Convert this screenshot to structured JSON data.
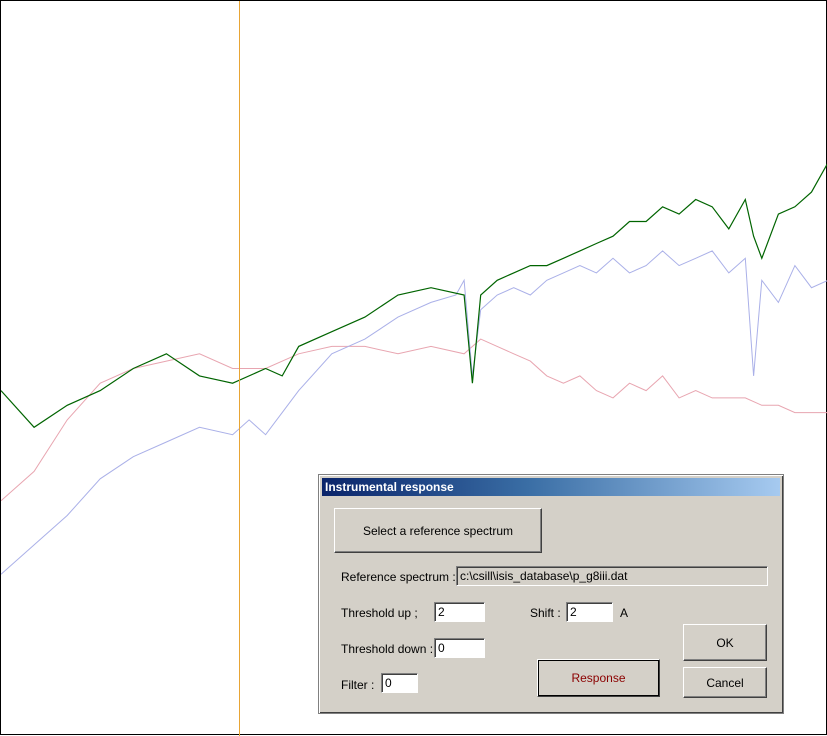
{
  "chart_data": {
    "type": "line",
    "x_range": [
      0,
      100
    ],
    "y_range": [
      0,
      1
    ],
    "grid": false,
    "legend": "none",
    "series": [
      {
        "color": "#006400",
        "x": [
          0,
          4,
          8,
          12,
          16,
          20,
          24,
          28,
          32,
          34,
          36,
          40,
          44,
          48,
          52,
          56,
          57,
          58,
          60,
          62,
          64,
          66,
          68,
          70,
          72,
          74,
          76,
          78,
          80,
          82,
          84,
          86,
          88,
          90,
          91,
          92,
          94,
          96,
          98,
          100
        ],
        "y": [
          0.47,
          0.42,
          0.45,
          0.47,
          0.5,
          0.52,
          0.49,
          0.48,
          0.5,
          0.49,
          0.53,
          0.55,
          0.57,
          0.6,
          0.61,
          0.6,
          0.48,
          0.6,
          0.62,
          0.63,
          0.64,
          0.64,
          0.65,
          0.66,
          0.67,
          0.68,
          0.7,
          0.7,
          0.72,
          0.71,
          0.73,
          0.72,
          0.69,
          0.73,
          0.68,
          0.65,
          0.71,
          0.72,
          0.74,
          0.78
        ]
      },
      {
        "color": "#aab0e8",
        "x": [
          0,
          4,
          8,
          12,
          16,
          20,
          24,
          28,
          30,
          32,
          34,
          36,
          40,
          44,
          48,
          52,
          55,
          56,
          57,
          58,
          60,
          62,
          64,
          66,
          68,
          70,
          72,
          74,
          76,
          78,
          80,
          82,
          84,
          86,
          88,
          90,
          91,
          92,
          94,
          96,
          98,
          100
        ],
        "y": [
          0.22,
          0.26,
          0.3,
          0.35,
          0.38,
          0.4,
          0.42,
          0.41,
          0.43,
          0.41,
          0.44,
          0.47,
          0.52,
          0.54,
          0.57,
          0.59,
          0.6,
          0.62,
          0.49,
          0.58,
          0.6,
          0.61,
          0.6,
          0.62,
          0.63,
          0.64,
          0.63,
          0.65,
          0.63,
          0.64,
          0.66,
          0.64,
          0.65,
          0.66,
          0.63,
          0.65,
          0.49,
          0.62,
          0.59,
          0.64,
          0.61,
          0.62
        ]
      },
      {
        "color": "#e8a5b0",
        "x": [
          0,
          4,
          8,
          12,
          16,
          20,
          24,
          28,
          32,
          36,
          40,
          44,
          48,
          52,
          56,
          58,
          60,
          62,
          64,
          66,
          68,
          70,
          72,
          74,
          76,
          78,
          80,
          82,
          84,
          86,
          88,
          90,
          92,
          94,
          96,
          98,
          100
        ],
        "y": [
          0.32,
          0.36,
          0.43,
          0.48,
          0.5,
          0.51,
          0.52,
          0.5,
          0.5,
          0.52,
          0.53,
          0.53,
          0.52,
          0.53,
          0.52,
          0.54,
          0.53,
          0.52,
          0.51,
          0.49,
          0.48,
          0.49,
          0.47,
          0.46,
          0.48,
          0.47,
          0.49,
          0.46,
          0.47,
          0.46,
          0.46,
          0.46,
          0.45,
          0.45,
          0.44,
          0.44,
          0.44
        ]
      }
    ]
  },
  "cursor": {
    "color": "#e8a535"
  },
  "dialog": {
    "title": "Instrumental response",
    "select_button": "Select a reference spectrum",
    "reference_label": "Reference spectrum :",
    "reference_value": "c:\\csill\\isis_database\\p_g8iii.dat",
    "threshold_up_label": "Threshold up ;",
    "threshold_up_value": "2",
    "shift_label": "Shift :",
    "shift_value": "2",
    "shift_unit": "A",
    "threshold_down_label": "Threshold down :",
    "threshold_down_value": "0",
    "filter_label": "Filter :",
    "filter_value": "0",
    "response_button": "Response",
    "ok_button": "OK",
    "cancel_button": "Cancel",
    "response_color": "#8b0000"
  }
}
